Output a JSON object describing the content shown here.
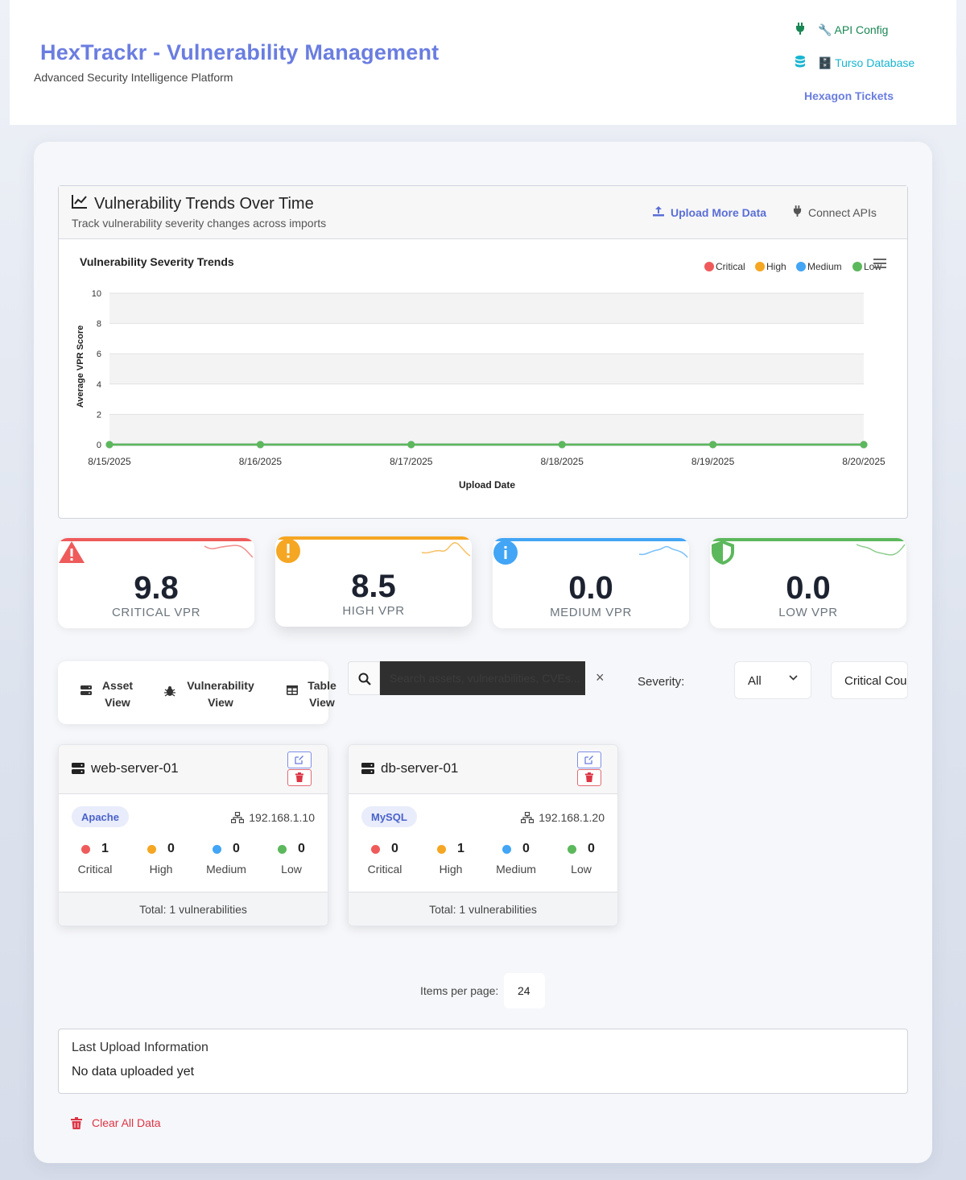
{
  "header": {
    "title": "HexTrackr - Vulnerability Management",
    "subtitle": "Advanced Security Intelligence Platform",
    "nav": {
      "api_config": "🔧 API Config",
      "turso_database": "🗄️ Turso Database",
      "hexagon_tickets": "Hexagon Tickets"
    },
    "icons": {
      "api_config": "plug-icon",
      "turso_database": "database-icon"
    }
  },
  "trends_card": {
    "title": "Vulnerability Trends Over Time",
    "subtitle": "Track vulnerability severity changes across imports",
    "upload_button": "Upload More Data",
    "connect_button": "Connect APIs"
  },
  "chart_data": {
    "type": "line",
    "title": "Vulnerability Severity Trends",
    "xlabel": "Upload Date",
    "ylabel": "Average VPR Score",
    "ylim": [
      0,
      10
    ],
    "yticks": [
      0,
      2,
      4,
      6,
      8,
      10
    ],
    "x": [
      "8/15/2025",
      "8/16/2025",
      "8/17/2025",
      "8/18/2025",
      "8/19/2025",
      "8/20/2025"
    ],
    "legend_position": "top-right",
    "grid": true,
    "series": [
      {
        "name": "Critical",
        "color": "#ef5b5b",
        "values": [
          0,
          0,
          0,
          0,
          0,
          0
        ]
      },
      {
        "name": "High",
        "color": "#f5a623",
        "values": [
          0,
          0,
          0,
          0,
          0,
          0
        ]
      },
      {
        "name": "Medium",
        "color": "#42a5f5",
        "values": [
          0,
          0,
          0,
          0,
          0,
          0
        ]
      },
      {
        "name": "Low",
        "color": "#5cb85c",
        "values": [
          0,
          0,
          0,
          0,
          0,
          0
        ]
      }
    ]
  },
  "vpr_cards": [
    {
      "value": "9.8",
      "label": "CRITICAL VPR",
      "color": "#ef5b5b",
      "icon": "warning-triangle-icon"
    },
    {
      "value": "8.5",
      "label": "HIGH VPR",
      "color": "#f5a623",
      "icon": "exclamation-circle-icon"
    },
    {
      "value": "0.0",
      "label": "MEDIUM VPR",
      "color": "#42a5f5",
      "icon": "info-circle-icon"
    },
    {
      "value": "0.0",
      "label": "LOW VPR",
      "color": "#5cb85c",
      "icon": "shield-icon"
    }
  ],
  "view_toggle": {
    "asset_view": [
      "Asset",
      "View"
    ],
    "vulnerability_view": [
      "Vulnerability",
      "View"
    ],
    "table_view": [
      "Table",
      "View"
    ]
  },
  "filters": {
    "search_placeholder": "Search assets, vulnerabilities, CVEs...",
    "clear": "×",
    "severity_label": "Severity:",
    "severity_value": "All",
    "sort_value": "Critical Count"
  },
  "assets": [
    {
      "name": "web-server-01",
      "tag": "Apache",
      "ip": "192.168.1.10",
      "counts": {
        "critical": "1",
        "high": "0",
        "medium": "0",
        "low": "0"
      },
      "total": "Total: 1 vulnerabilities"
    },
    {
      "name": "db-server-01",
      "tag": "MySQL",
      "ip": "192.168.1.20",
      "counts": {
        "critical": "0",
        "high": "1",
        "medium": "0",
        "low": "0"
      },
      "total": "Total: 1 vulnerabilities"
    }
  ],
  "severity_names": {
    "critical": "Critical",
    "high": "High",
    "medium": "Medium",
    "low": "Low"
  },
  "pagination": {
    "items_per_page_label": "Items per page:",
    "items_per_page_value": "24"
  },
  "upload_info": {
    "title": "Last Upload Information",
    "body": "No data uploaded yet"
  },
  "clear_all": "Clear All Data"
}
